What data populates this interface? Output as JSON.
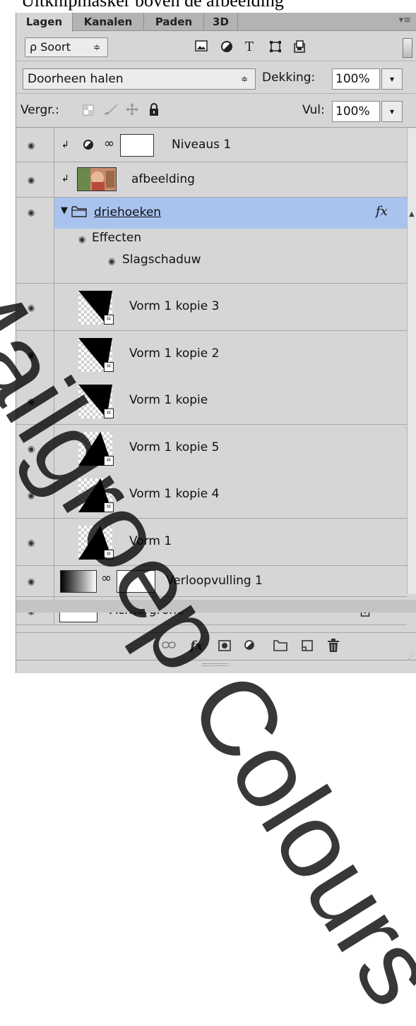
{
  "caption": "Uitknipmasker boven de afbeelding",
  "panel": {
    "tabs": [
      {
        "label": "Lagen",
        "active": true
      },
      {
        "label": "Kanalen",
        "active": false
      },
      {
        "label": "Paden",
        "active": false
      },
      {
        "label": "3D",
        "active": false
      }
    ],
    "menu_glyph": "▾≡"
  },
  "filter": {
    "kind_label": "Soort",
    "search_glyph": "ρ",
    "arrows": "≑",
    "type_icons": [
      "image-filter-icon",
      "adjustment-filter-icon",
      "type-filter-icon",
      "shape-filter-icon",
      "smartobject-filter-icon"
    ],
    "type_glyph": "T"
  },
  "blend": {
    "mode": "Doorheen halen",
    "opacity_label": "Dekking:",
    "opacity_value": "100%",
    "fill_label": "Vul:",
    "fill_value": "100%",
    "lock_label": "Vergr.:"
  },
  "layers": [
    {
      "name": "Niveaus 1",
      "type": "adjustment"
    },
    {
      "name": "afbeelding",
      "type": "image"
    },
    {
      "name": "driehoeken",
      "type": "group",
      "selected": true,
      "fx": "fx"
    },
    {
      "name": "Effecten",
      "type": "effects-header"
    },
    {
      "name": "Slagschaduw",
      "type": "effect"
    },
    {
      "name": "Vorm 1 kopie 3",
      "type": "shape",
      "shape": "down"
    },
    {
      "name": "Vorm 1 kopie 2",
      "type": "shape",
      "shape": "down"
    },
    {
      "name": "Vorm 1 kopie",
      "type": "shape",
      "shape": "down"
    },
    {
      "name": "Vorm 1 kopie 5",
      "type": "shape",
      "shape": "up"
    },
    {
      "name": "Vorm 1 kopie 4",
      "type": "shape",
      "shape": "up"
    },
    {
      "name": "Vorm 1",
      "type": "shape",
      "shape": "up"
    },
    {
      "name": "Verloopvulling 1",
      "type": "gradient"
    },
    {
      "name": "Achtergrond",
      "type": "background",
      "italic": true
    }
  ],
  "bottom_bar": {
    "icons": [
      "link-layers-icon",
      "fx-icon",
      "add-mask-icon",
      "new-adjustment-icon",
      "new-group-icon",
      "new-layer-icon",
      "delete-layer-icon"
    ],
    "fx_label": "fx"
  },
  "watermark": "Mailgroep Colours"
}
